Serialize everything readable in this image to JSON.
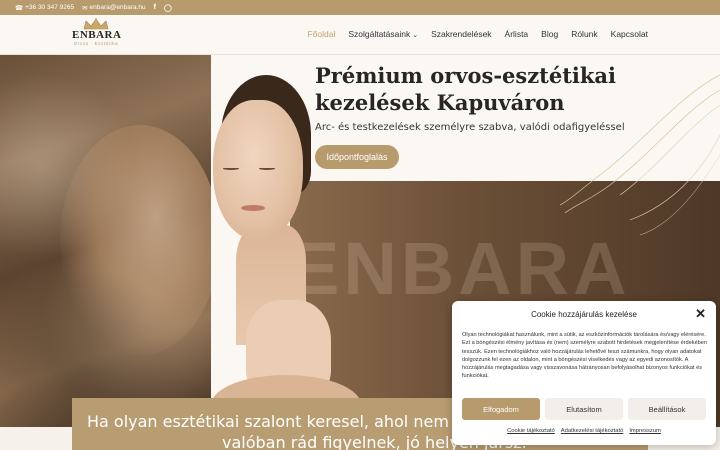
{
  "topbar": {
    "phone": "+36 30 347 9265",
    "email": "enbara@enbara.hu",
    "facebook_icon": "f",
    "instagram_icon": "ig"
  },
  "logo": {
    "name": "ENBARA",
    "subtitle": "Orvos · Esztétika"
  },
  "nav": {
    "items": [
      "Főoldal",
      "Szolgáltatásaink",
      "Szakrendelések",
      "Árlista",
      "Blog",
      "Rólunk",
      "Kapcsolat"
    ]
  },
  "hero": {
    "title_line1": "Prémium orvos-esztétikai",
    "title_line2": "kezelések Kapuváron",
    "subtitle": "Arc- és testkezelések személyre szabva, valódi odafigyeléssel",
    "cta": "Időpontfoglalás",
    "watermark": "ENBARA"
  },
  "band": {
    "line1": "Ha olyan esztétikai szalont keresel, ahol nem futószalagon",
    "line2": "valóban rád figyelnek, jó helyen jársz."
  },
  "cookie": {
    "title": "Cookie hozzájárulás kezelése",
    "body": "Olyan technológiákat használunk, mint a sütik, az eszközinformációk tárolására és/vagy elérésére. Ezt a böngészési élmény javítása és (nem) személyre szabott hirdetések megjelenítése érdekében tesszük. Ezen technológiákhoz való hozzájárulás lehetővé teszi számunkra, hogy olyan adatokat dolgozzunk fel ezen az oldalon, mint a böngészési viselkedés vagy az egyedi azonosítók. A hozzájárulás megtagadása vagy visszavonása hátrányosan befolyásolhat bizonyos funkciókat és funkciókat.",
    "accept": "Elfogadom",
    "reject": "Elutasítom",
    "settings": "Beállítások",
    "link_cookie": "Cookie tájékoztató",
    "link_privacy": "Adatkezelési tájékoztató",
    "link_imprint": "Impresszum"
  },
  "colors": {
    "accent": "#b89b6c",
    "dark_text": "#2a2520"
  }
}
